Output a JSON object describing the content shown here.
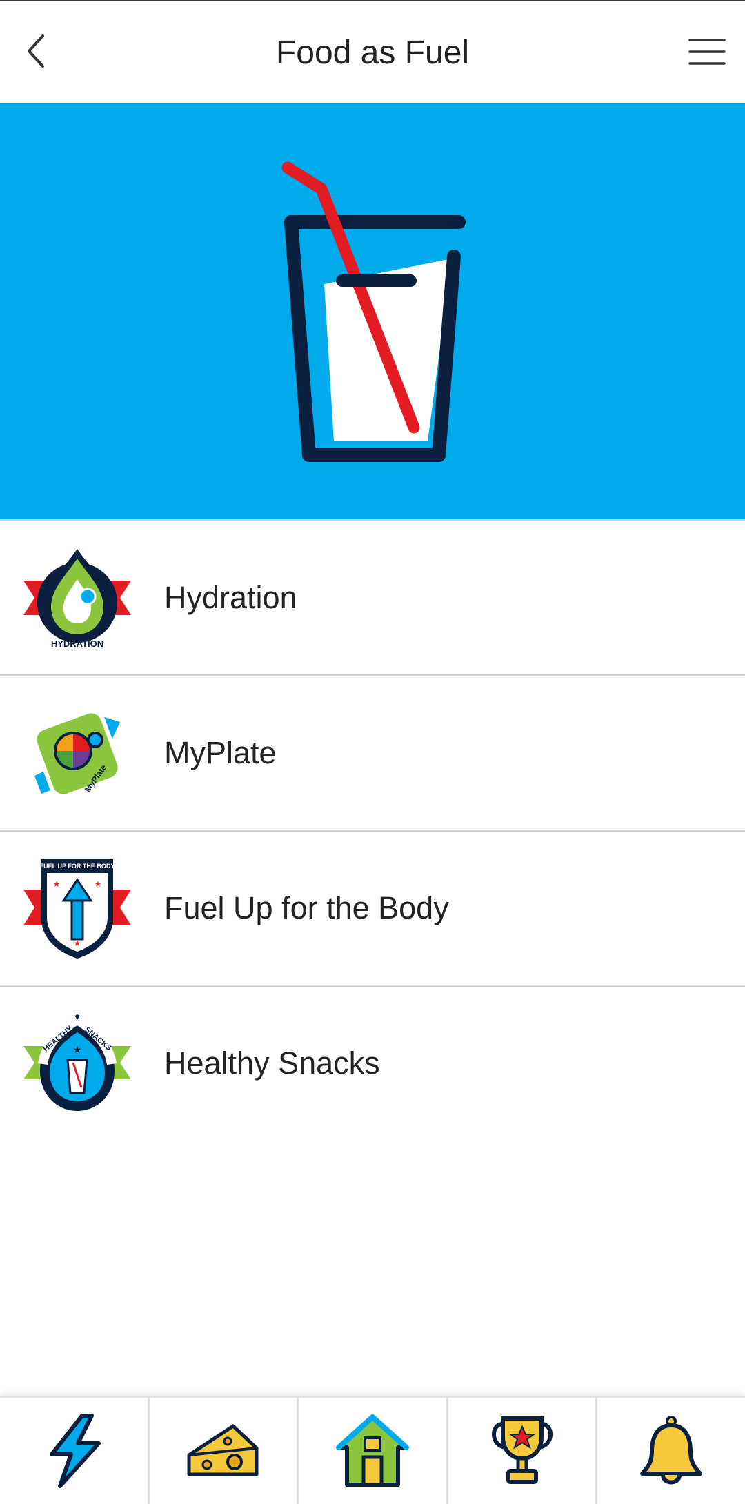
{
  "header": {
    "title": "Food as Fuel",
    "back_icon": "chevron-left-icon",
    "menu_icon": "hamburger-menu-icon"
  },
  "hero": {
    "illustration": "glass-with-straw-icon",
    "background_color": "#00aaeb"
  },
  "items": [
    {
      "label": "Hydration",
      "icon": "hydration-badge-icon"
    },
    {
      "label": "MyPlate",
      "icon": "myplate-badge-icon"
    },
    {
      "label": "Fuel Up for the Body",
      "icon": "fuel-up-badge-icon"
    },
    {
      "label": "Healthy Snacks",
      "icon": "healthy-snacks-badge-icon"
    }
  ],
  "badge_text": {
    "hydration": "HYDRATION",
    "myplate": "MyPlate",
    "fuel_up": "FUEL UP FOR THE BODY",
    "healthy": "HEALTHY",
    "snacks": "SNACKS"
  },
  "bottom_nav": [
    {
      "icon": "lightning-bolt-icon"
    },
    {
      "icon": "cheese-icon"
    },
    {
      "icon": "home-icon"
    },
    {
      "icon": "trophy-icon"
    },
    {
      "icon": "bell-icon"
    }
  ],
  "colors": {
    "accent_blue": "#00aaeb",
    "navy": "#0b1f3f",
    "red": "#e31b23",
    "green": "#8cc63f",
    "yellow": "#f6c83b"
  }
}
